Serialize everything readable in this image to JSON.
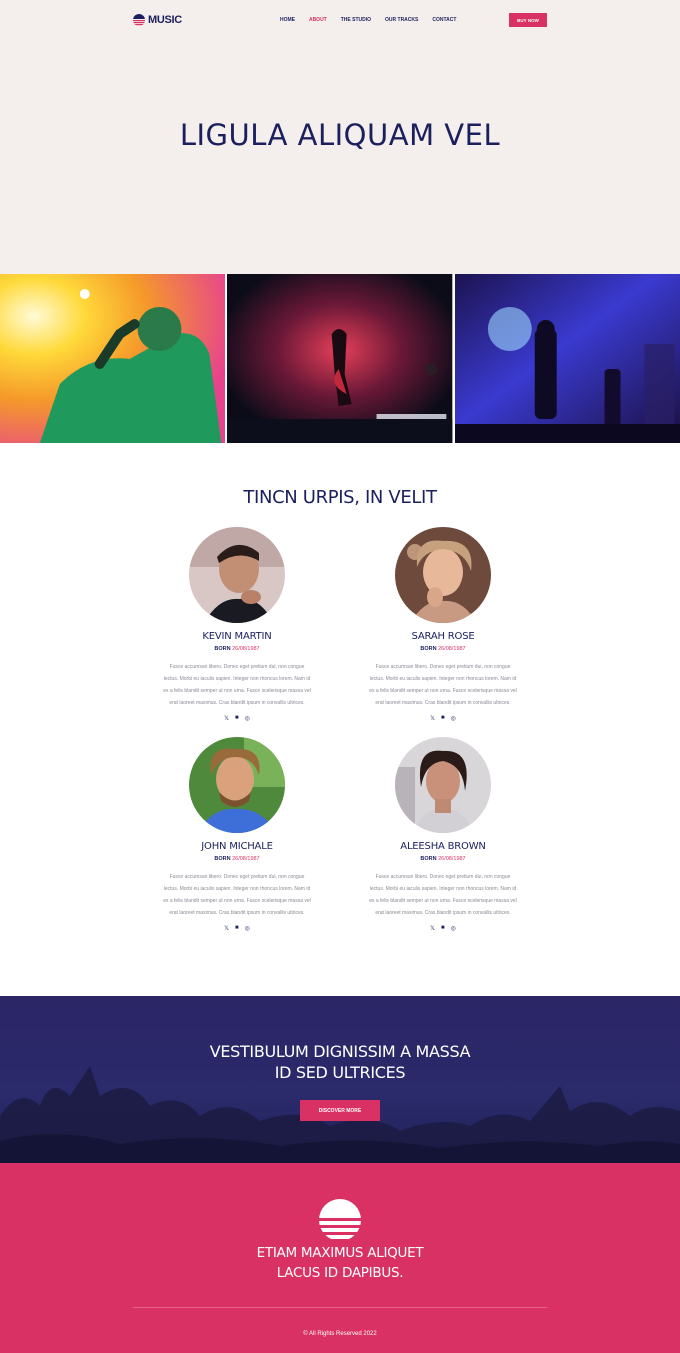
{
  "brand": {
    "name": "MUSIC",
    "accent": "#d93163",
    "navy": "#1b1f5e"
  },
  "nav": {
    "items": [
      {
        "label": "HOME",
        "active": false
      },
      {
        "label": "ABOUT",
        "active": true
      },
      {
        "label": "THE STUDIO",
        "active": false
      },
      {
        "label": "OUR TRACKS",
        "active": false
      },
      {
        "label": "CONTACT",
        "active": false
      }
    ],
    "buy_label": "BUY NOW"
  },
  "hero": {
    "title": "LIGULA ALIQUAM VEL"
  },
  "artists_section": {
    "title": "TINCN URPIS, IN VELIT",
    "born_prefix": "BORN",
    "artists": [
      {
        "name": "KEVIN MARTIN",
        "born": "26/08/1987",
        "bio": "Fusce accumsan libero. Donec eget pretium dui, non congue lectus. Morbi eu iaculis sapien. Integer non rhoncus lorem. Nam id ex a felis blandit semper ut non urna. Fusce scelerisque massa vel erat laoreet maximus. Cras blandit ipsum in convallis ultrices."
      },
      {
        "name": "SARAH ROSE",
        "born": "26/08/1987",
        "bio": "Fusce accumsan libero. Donec eget pretium dui, non congue lectus. Morbi eu iaculis sapien. Integer non rhoncus lorem. Nam id ex a felis blandit semper ut non urna. Fusce scelerisque massa vel erat laoreet maximus. Cras blandit ipsum in convallis ultrices."
      },
      {
        "name": "JOHN MICHALE",
        "born": "26/08/1987",
        "bio": "Fusce accumsan libero. Donec eget pretium dui, non congue lectus. Morbi eu iaculis sapien. Integer non rhoncus lorem. Nam id ex a felis blandit semper ut non urna. Fusce scelerisque massa vel erat laoreet maximus. Cras blandit ipsum in convallis ultrices."
      },
      {
        "name": "ALEESHA BROWN",
        "born": "26/08/1987",
        "bio": "Fusce accumsan libero. Donec eget pretium dui, non congue lectus. Morbi eu iaculis sapien. Integer non rhoncus lorem. Nam id ex a felis blandit semper ut non urna. Fusce scelerisque massa vel erat laoreet maximus. Cras blandit ipsum in convallis ultrices."
      }
    ]
  },
  "cta": {
    "title_line1": "VESTIBULUM DIGNISSIM A MASSA",
    "title_line2": "ID SED ULTRICES",
    "button_label": "DISCOVER MORE"
  },
  "footer": {
    "title_line1": "ETIAM MAXIMUS ALIQUET",
    "title_line2": "LACUS ID DAPIBUS.",
    "copyright": "© All Rights Reserved 2022"
  }
}
